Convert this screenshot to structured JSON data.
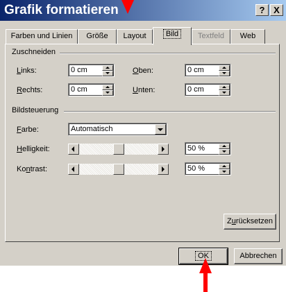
{
  "dialog": {
    "title": "Grafik formatieren",
    "help_label": "?",
    "close_label": "X"
  },
  "tabs": [
    {
      "label": "Farben und Linien",
      "state": "normal"
    },
    {
      "label": "Größe",
      "state": "normal"
    },
    {
      "label": "Layout",
      "state": "normal"
    },
    {
      "label": "Bild",
      "state": "active"
    },
    {
      "label": "Textfeld",
      "state": "disabled"
    },
    {
      "label": "Web",
      "state": "normal"
    }
  ],
  "crop": {
    "heading": "Zuschneiden",
    "left": {
      "mnemonic": "L",
      "rest": "inks:",
      "value": "0 cm"
    },
    "right": {
      "mnemonic": "R",
      "rest": "echts:",
      "value": "0 cm"
    },
    "top": {
      "mnemonic": "O",
      "rest": "ben:",
      "value": "0 cm"
    },
    "bottom": {
      "mnemonic": "U",
      "rest": "nten:",
      "value": "0 cm"
    }
  },
  "image_control": {
    "heading": "Bildsteuerung",
    "color": {
      "mnemonic": "F",
      "rest": "arbe:",
      "value": "Automatisch"
    },
    "brightness": {
      "mnemonic": "H",
      "rest": "elligkeit:",
      "value": "50 %",
      "level_percent": 50
    },
    "contrast": {
      "pre": "Ko",
      "mnemonic": "n",
      "rest": "trast:",
      "value": "50 %",
      "level_percent": 50
    },
    "reset": {
      "pre": "Z",
      "mnemonic": "u",
      "rest": "rücksetzen"
    }
  },
  "footer": {
    "ok_label": "OK",
    "cancel_label": "Abbrechen"
  },
  "annotations": {
    "arrow_color": "#ff0000"
  },
  "colors": {
    "title_start": "#0a246a",
    "title_end": "#a6caf0",
    "face": "#d4d0c8"
  }
}
